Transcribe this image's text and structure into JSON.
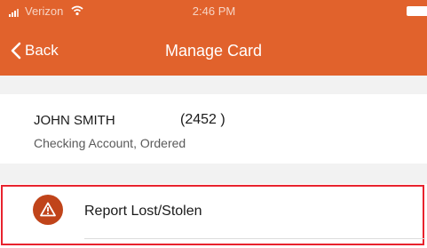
{
  "status_bar": {
    "carrier": "Verizon",
    "time": "2:46 PM",
    "signal_icon": "signal-bars-icon",
    "wifi_icon": "wifi-icon",
    "battery_icon": "battery-icon"
  },
  "nav": {
    "back_label": "Back",
    "title": "Manage Card"
  },
  "card": {
    "holder_name": "JOHN SMITH",
    "number_label": "(2452 )",
    "detail": "Checking Account, Ordered"
  },
  "actions": [
    {
      "label": "Report Lost/Stolen",
      "icon": "warning-triangle-icon"
    }
  ],
  "colors": {
    "header": "#e1622c",
    "alert_icon_bg": "#c0441a",
    "highlight_border": "#e8232e",
    "section_gap": "#f2f2f2"
  }
}
